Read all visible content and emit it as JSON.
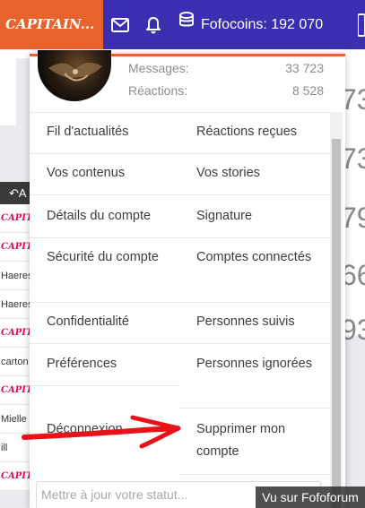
{
  "topbar": {
    "brand": "CAPITAIN...",
    "coins_label": "Fofocoins: 192 070",
    "icons": [
      "mail-icon",
      "bell-icon",
      "coins-icon"
    ],
    "colors": {
      "bar": "#3a2fb0",
      "brand": "#e8622c"
    }
  },
  "background": {
    "numbers": [
      "73",
      "73",
      "79",
      "66",
      "93"
    ],
    "reply_label": "A",
    "rows": [
      "CAPITAIN",
      "CAPITAIN",
      "Haeres",
      "Haeres",
      "CAPITAIN",
      "carton",
      "CAPITAIN",
      "Mielle",
      "ill",
      "CAPITAIN"
    ]
  },
  "profile": {
    "messages_label": "Messages:",
    "messages_value": "33 723",
    "reactions_label": "Réactions:",
    "reactions_value": "8 528"
  },
  "menu": {
    "items": [
      {
        "left": "Fil d'actualités",
        "right": "Réactions reçues"
      },
      {
        "left": "Vos contenus",
        "right": "Vos stories"
      },
      {
        "left": "Détails du compte",
        "right": "Signature"
      },
      {
        "left": "Sécurité du compte",
        "right": "Comptes connectés"
      },
      {
        "left": "Confidentialité",
        "right": "Personnes suivis"
      },
      {
        "left": "Préférences",
        "right": "Personnes ignorées"
      },
      {
        "left": "Déconnexion",
        "right": "Supprimer mon compte"
      }
    ],
    "status_placeholder": "Mettre à jour votre statut..."
  },
  "watermark": "Vu sur Fofoforum",
  "annotation": {
    "arrow_color": "#e8121a"
  }
}
